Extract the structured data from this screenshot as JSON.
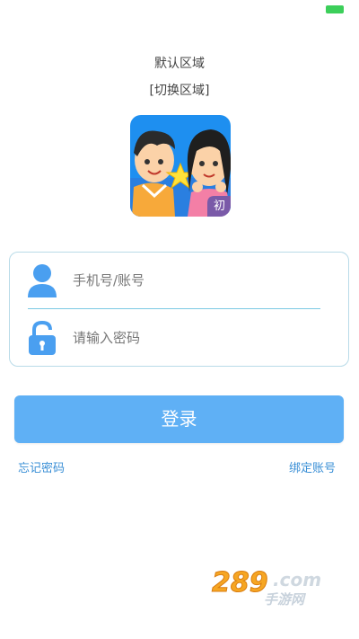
{
  "colors": {
    "accent": "#5fb0f5",
    "link": "#3a8fd6",
    "icon": "#4a9ff0",
    "card_border": "#b9dbe8",
    "battery": "#3ccf5a"
  },
  "header": {
    "region_label": "默认区域",
    "region_switch": "[切换区域]"
  },
  "logo": {
    "badge": "初"
  },
  "form": {
    "username_placeholder": "手机号/账号",
    "username_icon": "user-icon",
    "password_placeholder": "请输入密码",
    "password_icon": "padlock-icon"
  },
  "actions": {
    "login_label": "登录",
    "forgot_password": "忘记密码",
    "bind_account": "绑定账号"
  },
  "watermark": {
    "text": "289.com",
    "subtitle": "手游网"
  }
}
